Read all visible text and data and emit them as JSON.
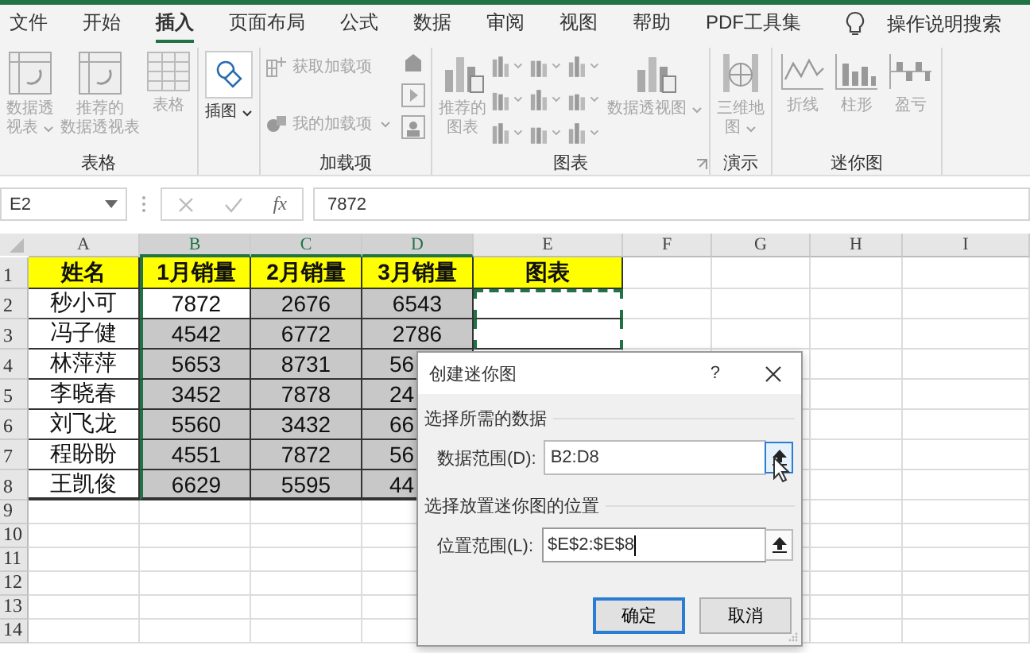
{
  "menu_tabs": [
    {
      "label": "文件",
      "selected": false
    },
    {
      "label": "开始",
      "selected": false
    },
    {
      "label": "插入",
      "selected": true
    },
    {
      "label": "页面布局",
      "selected": false
    },
    {
      "label": "公式",
      "selected": false
    },
    {
      "label": "数据",
      "selected": false
    },
    {
      "label": "审阅",
      "selected": false
    },
    {
      "label": "视图",
      "selected": false
    },
    {
      "label": "帮助",
      "selected": false
    },
    {
      "label": "PDF工具集",
      "selected": false
    }
  ],
  "tell_me": "操作说明搜索",
  "ribbon_groups": [
    {
      "label": "表格",
      "items": [
        {
          "kind": "large",
          "lines": [
            "数据透",
            "视表"
          ],
          "dropdown": true,
          "disabled": true
        },
        {
          "kind": "large",
          "lines": [
            "推荐的",
            "数据透视表"
          ],
          "dropdown": false,
          "disabled": true
        },
        {
          "kind": "large",
          "lines": [
            "表格"
          ],
          "dropdown": false,
          "disabled": true
        }
      ]
    },
    {
      "items": [
        {
          "kind": "large",
          "lines": [
            "插图"
          ],
          "dropdown": true,
          "disabled": false
        }
      ]
    },
    {
      "label": "加载项",
      "items": [
        {
          "kind": "small",
          "text": "获取加载项",
          "dropdown": false,
          "disabled": true
        },
        {
          "kind": "small",
          "text": "我的加载项",
          "dropdown": true,
          "disabled": true
        },
        {
          "kind": "icon_stack"
        }
      ]
    },
    {
      "label": "图表",
      "launcher": true,
      "items": [
        {
          "kind": "large",
          "lines": [
            "推荐的",
            "图表"
          ],
          "dropdown": false,
          "disabled": true
        },
        {
          "kind": "chart_gallery"
        },
        {
          "kind": "large",
          "lines": [
            "数据透视图"
          ],
          "dropdown": true,
          "disabled": true
        }
      ]
    },
    {
      "label": "演示",
      "items": [
        {
          "kind": "large",
          "lines": [
            "三维地",
            "图"
          ],
          "dropdown": true,
          "disabled": true
        }
      ]
    },
    {
      "label": "迷你图",
      "items": [
        {
          "kind": "large",
          "lines": [
            "折线"
          ],
          "dropdown": false,
          "disabled": true
        },
        {
          "kind": "large",
          "lines": [
            "柱形"
          ],
          "dropdown": false,
          "disabled": true
        },
        {
          "kind": "large",
          "lines": [
            "盈亏"
          ],
          "dropdown": false,
          "disabled": true
        }
      ]
    }
  ],
  "name_box": "E2",
  "fx": "fx",
  "formula_value": "7872",
  "columns": [
    {
      "label": "A",
      "selected": false
    },
    {
      "label": "B",
      "selected": true
    },
    {
      "label": "C",
      "selected": true
    },
    {
      "label": "D",
      "selected": true
    },
    {
      "label": "E",
      "selected": false
    },
    {
      "label": "F",
      "selected": false
    },
    {
      "label": "G",
      "selected": false
    },
    {
      "label": "H",
      "selected": false
    },
    {
      "label": "I",
      "selected": false
    }
  ],
  "rows": [
    {
      "number": "1",
      "cells": [
        {
          "text": "姓名",
          "kind": "header"
        },
        {
          "text": "1月销量",
          "kind": "header"
        },
        {
          "text": "2月销量",
          "kind": "header"
        },
        {
          "text": "3月销量",
          "kind": "header"
        },
        {
          "text": "图表",
          "kind": "header"
        }
      ]
    },
    {
      "number": "2",
      "cells": [
        {
          "text": "秒小可",
          "kind": "normal"
        },
        {
          "text": "7872",
          "kind": "active"
        },
        {
          "text": "2676",
          "kind": "selected"
        },
        {
          "text": "6543",
          "kind": "selected"
        },
        {
          "kind": "marquee"
        }
      ]
    },
    {
      "number": "3",
      "cells": [
        {
          "text": "冯子健",
          "kind": "normal"
        },
        {
          "text": "4542",
          "kind": "selected"
        },
        {
          "text": "6772",
          "kind": "selected"
        },
        {
          "text": "2786",
          "kind": "selected"
        },
        {
          "kind": "marquee"
        }
      ]
    },
    {
      "number": "4",
      "cells": [
        {
          "text": "林萍萍",
          "kind": "normal"
        },
        {
          "text": "5653",
          "kind": "selected"
        },
        {
          "text": "8731",
          "kind": "selected"
        },
        {
          "text": "56",
          "kind": "selected",
          "cut": true
        }
      ]
    },
    {
      "number": "5",
      "cells": [
        {
          "text": "李晓春",
          "kind": "normal"
        },
        {
          "text": "3452",
          "kind": "selected"
        },
        {
          "text": "7878",
          "kind": "selected"
        },
        {
          "text": "24",
          "kind": "selected",
          "cut": true
        }
      ]
    },
    {
      "number": "6",
      "cells": [
        {
          "text": "刘飞龙",
          "kind": "normal"
        },
        {
          "text": "5560",
          "kind": "selected"
        },
        {
          "text": "3432",
          "kind": "selected"
        },
        {
          "text": "66",
          "kind": "selected",
          "cut": true
        }
      ]
    },
    {
      "number": "7",
      "cells": [
        {
          "text": "程盼盼",
          "kind": "normal"
        },
        {
          "text": "4551",
          "kind": "selected"
        },
        {
          "text": "7872",
          "kind": "selected"
        },
        {
          "text": "56",
          "kind": "selected",
          "cut": true
        }
      ]
    },
    {
      "number": "8",
      "cells": [
        {
          "text": "王凯俊",
          "kind": "normal"
        },
        {
          "text": "6629",
          "kind": "selected"
        },
        {
          "text": "5595",
          "kind": "selected"
        },
        {
          "text": "44",
          "kind": "selected",
          "cut": true
        }
      ]
    },
    {
      "number": "9",
      "cells": []
    },
    {
      "number": "10",
      "cells": []
    },
    {
      "number": "11",
      "cells": []
    },
    {
      "number": "12",
      "cells": []
    },
    {
      "number": "13",
      "cells": []
    },
    {
      "number": "14",
      "cells": []
    }
  ],
  "dialog": {
    "title": "创建迷你图",
    "help": "?",
    "sections": [
      {
        "heading": "选择所需的数据",
        "label": "数据范围(D):",
        "value": "B2:D8",
        "focused": false
      },
      {
        "heading": "选择放置迷你图的位置",
        "label": "位置范围(L):",
        "value": "$E$2:$E$8",
        "focused": true
      }
    ],
    "buttons": [
      {
        "label": "确定",
        "default": true
      },
      {
        "label": "取消",
        "default": false
      }
    ]
  }
}
